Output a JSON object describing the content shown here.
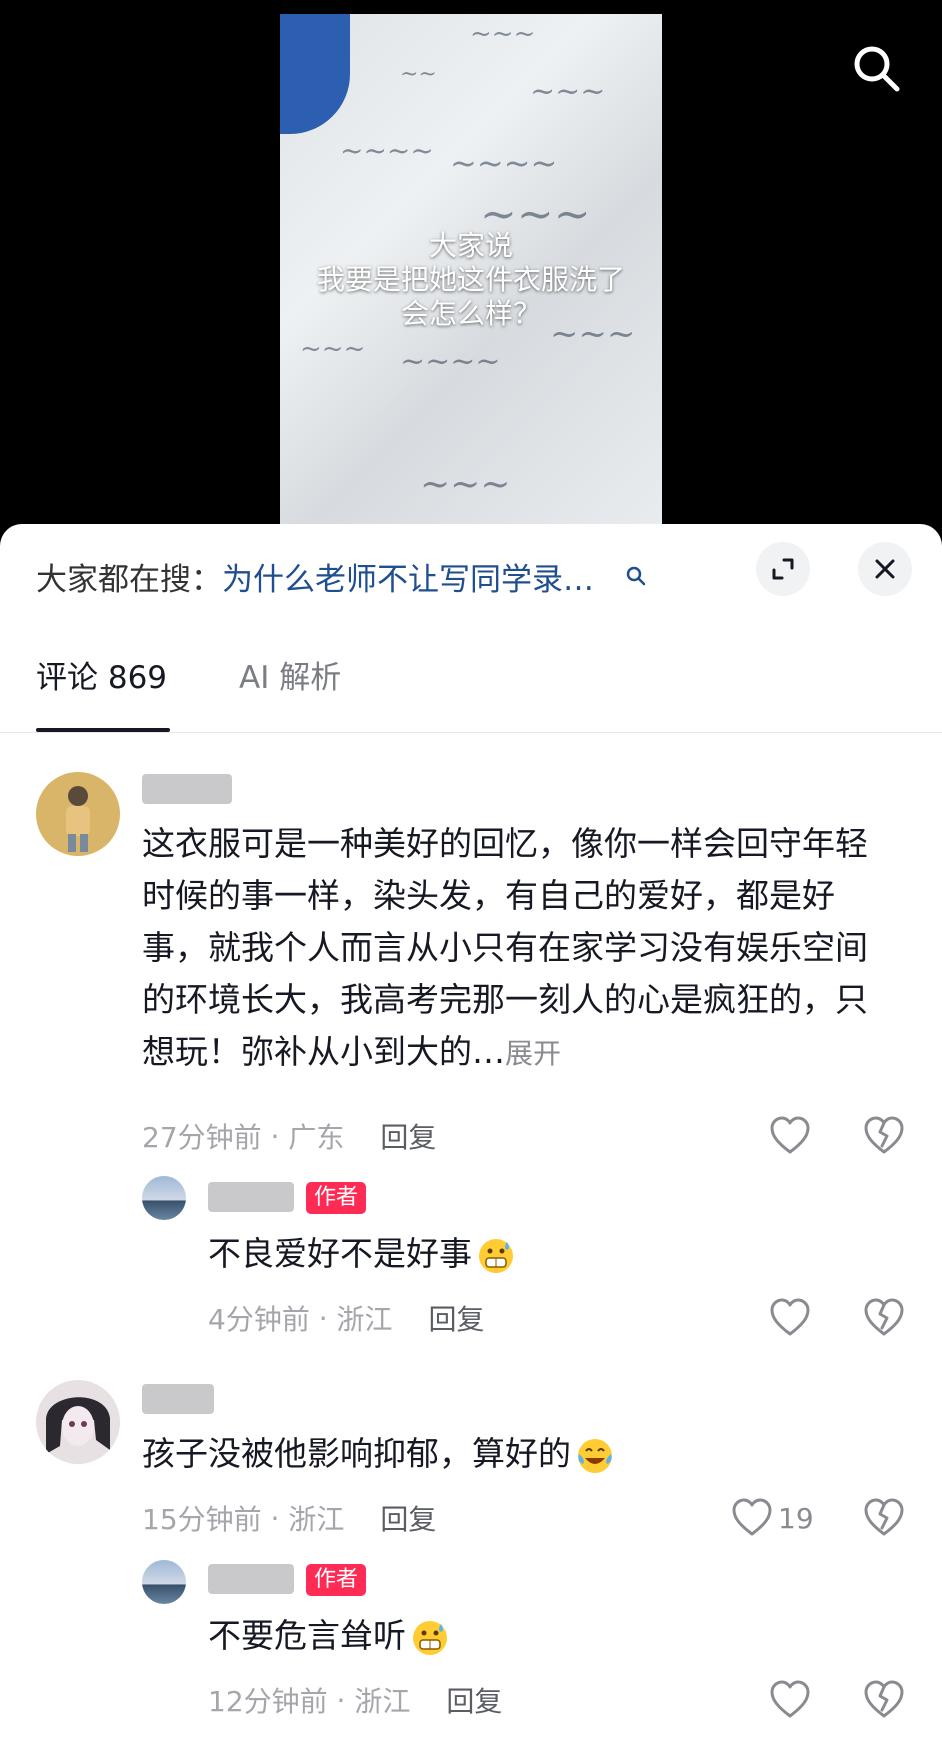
{
  "video": {
    "caption_lines": [
      "大家说",
      "我要是把她这件衣服洗了",
      "会怎么样？"
    ]
  },
  "hot_search": {
    "prefix": "大家都在搜：",
    "query": "为什么老师不让写同学录…"
  },
  "tabs": [
    {
      "label": "评论 869",
      "active": true
    },
    {
      "label": "AI 解析",
      "active": false
    }
  ],
  "comments": [
    {
      "lines": [
        "这衣服可是一种美好的回忆，像你一样会回守年轻",
        "时候的事一样，染头发，有自己的爱好，都是好",
        "事，就我个人而言从小只有在家学习没有娱乐空间",
        "的环境长大，我高考完那一刻人的心是疯狂的，只",
        "想玩！弥补从小到大的…"
      ],
      "expand": "展开",
      "time": "27分钟前",
      "location": "广东",
      "reply": "回复",
      "reply_item": {
        "badge": "作者",
        "text": "不良爱好不是好事",
        "emoji": "grimace-sweat",
        "time": "4分钟前",
        "location": "浙江",
        "reply": "回复"
      }
    },
    {
      "lines": [
        "孩子没被他影响抑郁，算好的"
      ],
      "emoji": "crying-laughing",
      "time": "15分钟前",
      "location": "浙江",
      "reply": "回复",
      "likes": "19",
      "reply_item": {
        "badge": "作者",
        "text": "不要危言耸听",
        "emoji": "grimace-sweat",
        "time": "12分钟前",
        "location": "浙江",
        "reply": "回复"
      }
    }
  ],
  "icons": {
    "search": "search-icon",
    "expand": "expand-icon",
    "close": "close-icon",
    "like": "heart-outline-icon",
    "dislike": "broken-heart-icon"
  },
  "colors": {
    "author_badge": "#fe2c55",
    "hot_search_query": "#1f4f8f"
  }
}
